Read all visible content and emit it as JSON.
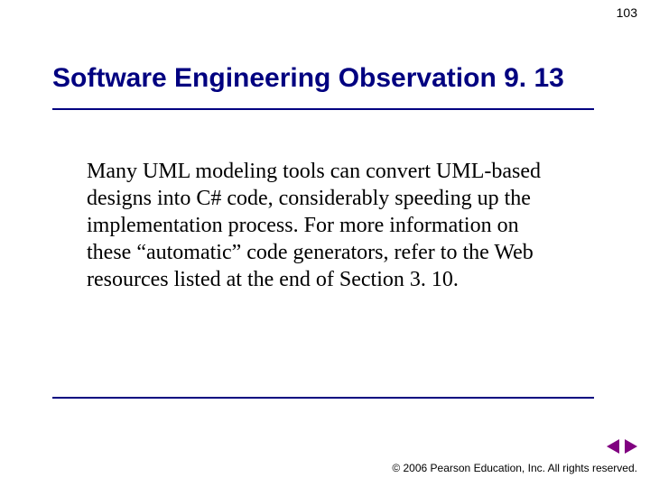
{
  "page_number": "103",
  "title": "Software Engineering Observation 9. 13",
  "body": "Many UML modeling tools can convert UML-based designs into C# code, considerably speeding up the implementation process. For more information on these “automatic” code generators, refer to the Web resources listed at the end of Section 3. 10.",
  "copyright": "© 2006 Pearson Education, Inc.  All rights reserved.",
  "colors": {
    "title": "#000080",
    "rule": "#000080",
    "nav_arrow": "#800080"
  },
  "nav": {
    "prev": "previous slide",
    "next": "next slide"
  }
}
